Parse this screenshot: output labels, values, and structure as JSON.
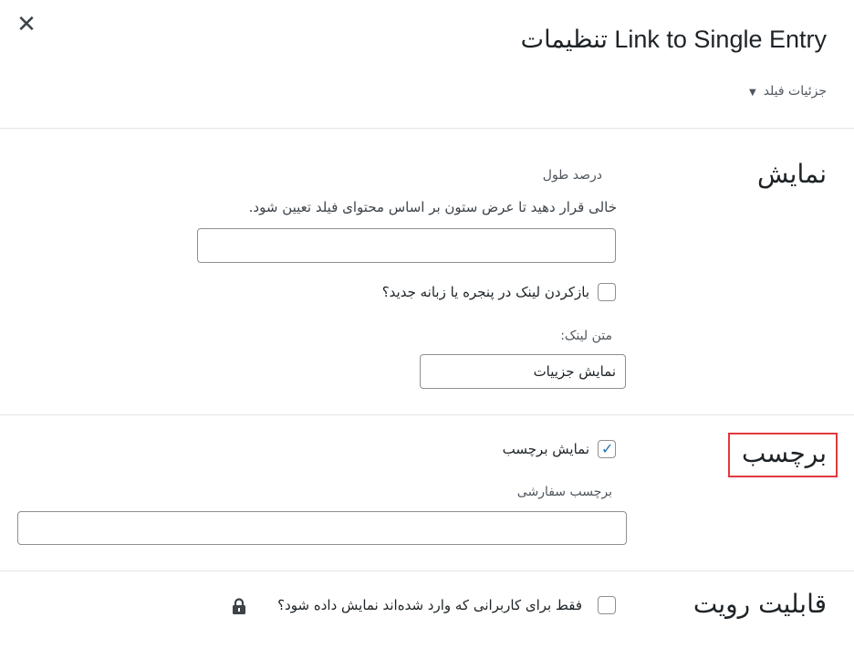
{
  "header": {
    "close_icon": "close-icon",
    "title": "Link to Single Entry تنظیمات",
    "details_label": "جزئیات فیلد"
  },
  "display_section": {
    "title": "نمایش",
    "width_label": "درصد طول",
    "width_description": "خالی قرار دهید تا عرض ستون بر اساس محتوای فیلد تعیین شود.",
    "width_value": "",
    "new_window_label": "بازکردن لینک در پنجره یا زبانه جدید؟",
    "new_window_checked": false,
    "link_text_label": "متن لینک:",
    "link_text_value": "نمایش جزییات"
  },
  "label_section": {
    "title": "برچسب",
    "show_label": "نمایش برچسب",
    "show_label_checked": true,
    "custom_label_label": "برچسب سفارشی",
    "custom_label_value": ""
  },
  "visibility_section": {
    "title": "قابلیت رویت",
    "logged_in_label": "فقط برای کاربرانی که وارد شده‌اند نمایش داده شود؟",
    "logged_in_checked": false,
    "lock_icon": "lock-icon"
  },
  "colors": {
    "accent": "#2271b1",
    "highlight": "#e0393e"
  }
}
